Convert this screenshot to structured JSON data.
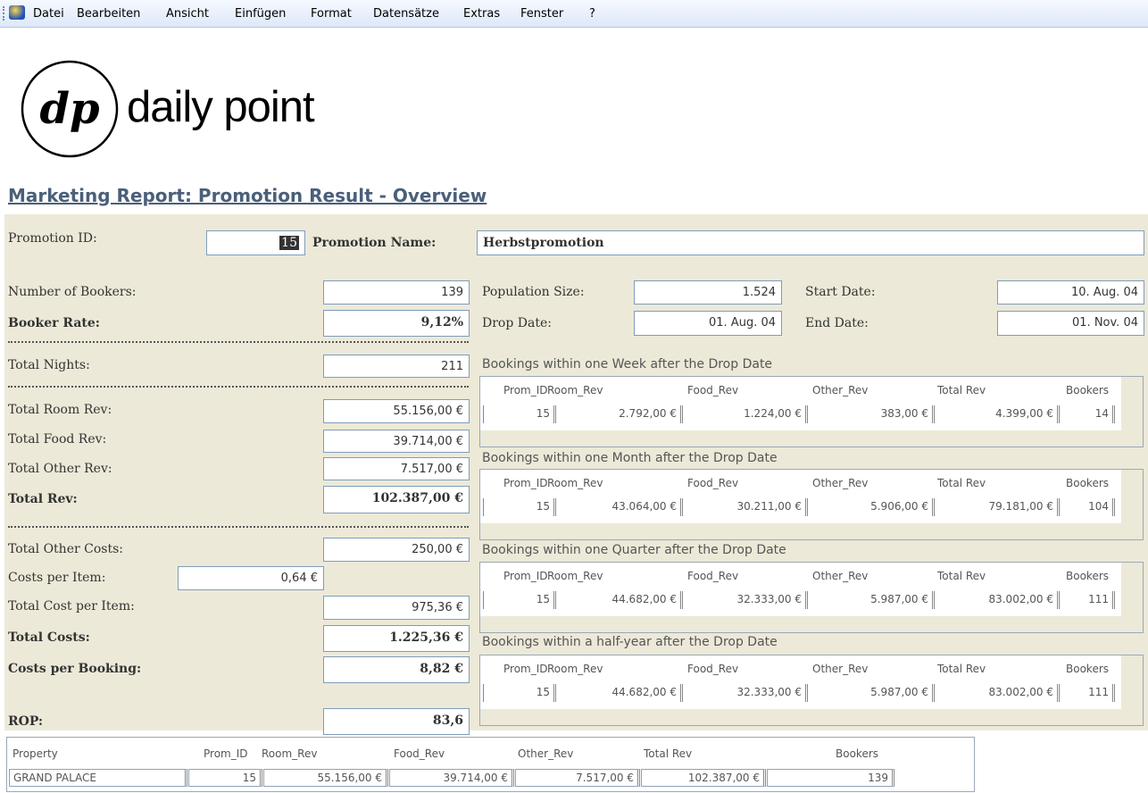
{
  "menu": [
    "Datei",
    "Bearbeiten",
    "Ansicht",
    "Einfügen",
    "Format",
    "Datensätze",
    "Extras",
    "Fenster",
    "?"
  ],
  "brand": {
    "logo_text": "dp",
    "name": "daily point"
  },
  "title": "Marketing Report: Promotion Result - Overview",
  "promo": {
    "id_label": "Promotion ID:",
    "id": "15",
    "name_label": "Promotion Name:",
    "name": "Herbstpromotion"
  },
  "left": {
    "bookers_label": "Number of Bookers:",
    "bookers": "139",
    "rate_label": "Booker Rate:",
    "rate": "9,12%",
    "nights_label": "Total Nights:",
    "nights": "211",
    "room_label": "Total Room Rev:",
    "room": "55.156,00 €",
    "food_label": "Total Food Rev:",
    "food": "39.714,00 €",
    "other_label": "Total Other Rev:",
    "other": "7.517,00 €",
    "rev_label": "Total Rev:",
    "rev": "102.387,00 €",
    "oc_label": "Total Other Costs:",
    "oc": "250,00 €",
    "cpi_label": "Costs per Item:",
    "cpi": "0,64 €",
    "tcpi_label": "Total Cost per Item:",
    "tcpi": "975,36 €",
    "tc_label": "Total Costs:",
    "tc": "1.225,36 €",
    "cpb_label": "Costs per Booking:",
    "cpb": "8,82 €",
    "rop_label": "ROP:",
    "rop": "83,6"
  },
  "right": {
    "pop_label": "Population Size:",
    "pop": "1.524",
    "drop_label": "Drop Date:",
    "drop": "01. Aug. 04",
    "start_label": "Start Date:",
    "start": "10. Aug. 04",
    "end_label": "End Date:",
    "end": "01. Nov. 04"
  },
  "col_headers": [
    "Prom_ID",
    "Room_Rev",
    "Food_Rev",
    "Other_Rev",
    "Total Rev",
    "Bookers"
  ],
  "sections": [
    {
      "title": "Bookings within one Week after the Drop Date",
      "values": [
        "15",
        "2.792,00 €",
        "1.224,00 €",
        "383,00 €",
        "4.399,00 €",
        "14"
      ]
    },
    {
      "title": "Bookings within one Month after the Drop Date",
      "values": [
        "15",
        "43.064,00 €",
        "30.211,00 €",
        "5.906,00 €",
        "79.181,00 €",
        "104"
      ]
    },
    {
      "title": "Bookings within one Quarter after the Drop Date",
      "values": [
        "15",
        "44.682,00 €",
        "32.333,00 €",
        "5.987,00 €",
        "83.002,00 €",
        "111"
      ]
    },
    {
      "title": "Bookings within a half-year after the Drop Date",
      "values": [
        "15",
        "44.682,00 €",
        "32.333,00 €",
        "5.987,00 €",
        "83.002,00 €",
        "111"
      ]
    }
  ],
  "bottom": {
    "headers": [
      "Property",
      "Prom_ID",
      "Room_Rev",
      "Food_Rev",
      "Other_Rev",
      "Total Rev",
      "Bookers"
    ],
    "values": [
      "GRAND PALACE",
      "15",
      "55.156,00 €",
      "39.714,00 €",
      "7.517,00 €",
      "102.387,00 €",
      "139"
    ]
  }
}
